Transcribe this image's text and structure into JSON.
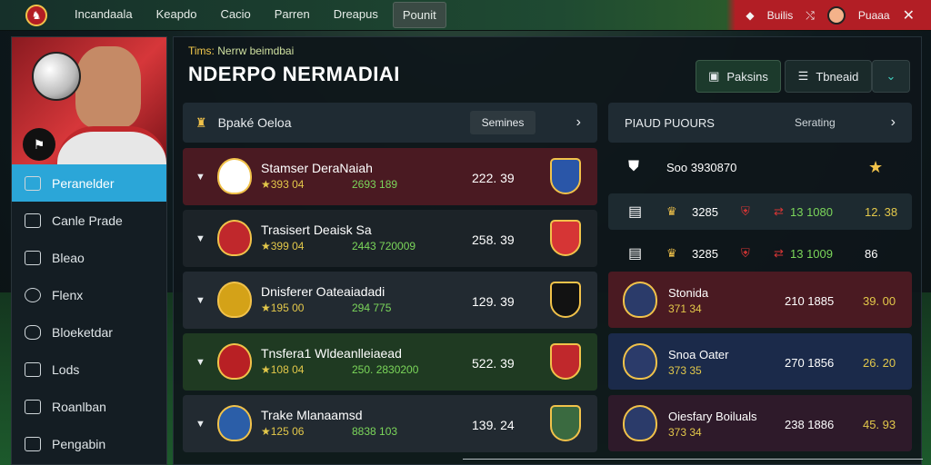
{
  "nav": {
    "items": [
      "Incandaala",
      "Keapdo",
      "Cacio",
      "Parren",
      "Dreapus",
      "Pounit"
    ],
    "active_index": 5
  },
  "topright": {
    "item1": "Builis",
    "item2": "Puaaa"
  },
  "sidebar": {
    "items": [
      "Peranelder",
      "Canle Prade",
      "Bleao",
      "Flenx",
      "Bloeketdar",
      "Lods",
      "Roanlban",
      "Pengabin"
    ],
    "active_index": 0
  },
  "header": {
    "subtitle_label": "Tims:",
    "subtitle_text": "Nerrw beimdbai",
    "title": "NDERPO NERMADIAI",
    "btn_a": "Paksins",
    "btn_b": "Tbneaid"
  },
  "left": {
    "head_title": "Bpaké Oeloa",
    "head_pill": "Semines",
    "rows": [
      {
        "name": "Stamser DeraNaiah",
        "stat1": "★393 04",
        "stat2": "2693 189",
        "score": "222. 39",
        "bg": "#4a1a22",
        "crest_l": "#ffffff",
        "crest_r": "#2a56a8"
      },
      {
        "name": "Trasisert Deaisk Sa",
        "stat1": "★399 04",
        "stat2": "2443 720009",
        "score": "258. 39",
        "bg": "#1c2328",
        "crest_l": "#c0282c",
        "crest_r": "#d63535"
      },
      {
        "name": "Dnisferer Oateaiadadi",
        "stat1": "★195 00",
        "stat2": "294 775",
        "score": "129. 39",
        "bg": "#222a31",
        "crest_l": "#d4a218",
        "crest_r": "#121212"
      },
      {
        "name": "Tnsfera1 Wldeanlleiaead",
        "stat1": "★108 04",
        "stat2": "250. 2830200",
        "score": "522. 39",
        "bg": "#1f3a22",
        "crest_l": "#b82024",
        "crest_r": "#c0282c"
      },
      {
        "name": "Trake Mlanaamsd",
        "stat1": "★125 06",
        "stat2": "8838 103",
        "score": "139. 24",
        "bg": "#222a31",
        "crest_l": "#2b5ea8",
        "crest_r": "#3a6a40"
      }
    ]
  },
  "right": {
    "head_title": "PIAUD PUOURS",
    "head_sort": "Serating",
    "top": {
      "name": "Soo 3930870"
    },
    "plain": [
      {
        "a": "3285",
        "b": "13 1080",
        "c": "12. 38",
        "c_color": "#e3c84a"
      },
      {
        "a": "3285",
        "b": "13 1009",
        "c": "86",
        "c_color": "#ffffff"
      }
    ],
    "cards": [
      {
        "name": "Stonida",
        "s1": "371 34",
        "s2": "210 1885",
        "s3": "39. 00",
        "bg": "#4a1a22"
      },
      {
        "name": "Snoa Oater",
        "s1": "373 35",
        "s2": "270 1856",
        "s3": "26. 20",
        "bg": "#1b2a4a"
      },
      {
        "name": "Oiesfary Boiluals",
        "s1": "373 34",
        "s2": "238 1886",
        "s3": "45. 93",
        "bg": "#2e1a2a"
      }
    ]
  },
  "colors": {
    "accent": "#2ba6d8",
    "brand_red": "#b21e25",
    "gold": "#f1c24a",
    "green_stat": "#7bd65a"
  }
}
